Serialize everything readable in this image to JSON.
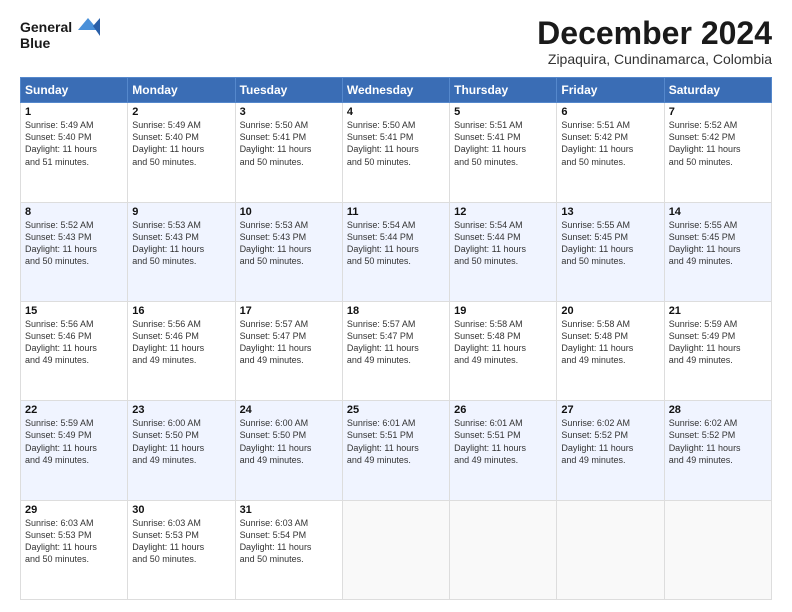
{
  "header": {
    "title": "December 2024",
    "subtitle": "Zipaquira, Cundinamarca, Colombia",
    "logo_line1": "General",
    "logo_line2": "Blue"
  },
  "days_of_week": [
    "Sunday",
    "Monday",
    "Tuesday",
    "Wednesday",
    "Thursday",
    "Friday",
    "Saturday"
  ],
  "weeks": [
    [
      {
        "day": 1,
        "info": "Sunrise: 5:49 AM\nSunset: 5:40 PM\nDaylight: 11 hours\nand 51 minutes."
      },
      {
        "day": 2,
        "info": "Sunrise: 5:49 AM\nSunset: 5:40 PM\nDaylight: 11 hours\nand 50 minutes."
      },
      {
        "day": 3,
        "info": "Sunrise: 5:50 AM\nSunset: 5:41 PM\nDaylight: 11 hours\nand 50 minutes."
      },
      {
        "day": 4,
        "info": "Sunrise: 5:50 AM\nSunset: 5:41 PM\nDaylight: 11 hours\nand 50 minutes."
      },
      {
        "day": 5,
        "info": "Sunrise: 5:51 AM\nSunset: 5:41 PM\nDaylight: 11 hours\nand 50 minutes."
      },
      {
        "day": 6,
        "info": "Sunrise: 5:51 AM\nSunset: 5:42 PM\nDaylight: 11 hours\nand 50 minutes."
      },
      {
        "day": 7,
        "info": "Sunrise: 5:52 AM\nSunset: 5:42 PM\nDaylight: 11 hours\nand 50 minutes."
      }
    ],
    [
      {
        "day": 8,
        "info": "Sunrise: 5:52 AM\nSunset: 5:43 PM\nDaylight: 11 hours\nand 50 minutes."
      },
      {
        "day": 9,
        "info": "Sunrise: 5:53 AM\nSunset: 5:43 PM\nDaylight: 11 hours\nand 50 minutes."
      },
      {
        "day": 10,
        "info": "Sunrise: 5:53 AM\nSunset: 5:43 PM\nDaylight: 11 hours\nand 50 minutes."
      },
      {
        "day": 11,
        "info": "Sunrise: 5:54 AM\nSunset: 5:44 PM\nDaylight: 11 hours\nand 50 minutes."
      },
      {
        "day": 12,
        "info": "Sunrise: 5:54 AM\nSunset: 5:44 PM\nDaylight: 11 hours\nand 50 minutes."
      },
      {
        "day": 13,
        "info": "Sunrise: 5:55 AM\nSunset: 5:45 PM\nDaylight: 11 hours\nand 50 minutes."
      },
      {
        "day": 14,
        "info": "Sunrise: 5:55 AM\nSunset: 5:45 PM\nDaylight: 11 hours\nand 49 minutes."
      }
    ],
    [
      {
        "day": 15,
        "info": "Sunrise: 5:56 AM\nSunset: 5:46 PM\nDaylight: 11 hours\nand 49 minutes."
      },
      {
        "day": 16,
        "info": "Sunrise: 5:56 AM\nSunset: 5:46 PM\nDaylight: 11 hours\nand 49 minutes."
      },
      {
        "day": 17,
        "info": "Sunrise: 5:57 AM\nSunset: 5:47 PM\nDaylight: 11 hours\nand 49 minutes."
      },
      {
        "day": 18,
        "info": "Sunrise: 5:57 AM\nSunset: 5:47 PM\nDaylight: 11 hours\nand 49 minutes."
      },
      {
        "day": 19,
        "info": "Sunrise: 5:58 AM\nSunset: 5:48 PM\nDaylight: 11 hours\nand 49 minutes."
      },
      {
        "day": 20,
        "info": "Sunrise: 5:58 AM\nSunset: 5:48 PM\nDaylight: 11 hours\nand 49 minutes."
      },
      {
        "day": 21,
        "info": "Sunrise: 5:59 AM\nSunset: 5:49 PM\nDaylight: 11 hours\nand 49 minutes."
      }
    ],
    [
      {
        "day": 22,
        "info": "Sunrise: 5:59 AM\nSunset: 5:49 PM\nDaylight: 11 hours\nand 49 minutes."
      },
      {
        "day": 23,
        "info": "Sunrise: 6:00 AM\nSunset: 5:50 PM\nDaylight: 11 hours\nand 49 minutes."
      },
      {
        "day": 24,
        "info": "Sunrise: 6:00 AM\nSunset: 5:50 PM\nDaylight: 11 hours\nand 49 minutes."
      },
      {
        "day": 25,
        "info": "Sunrise: 6:01 AM\nSunset: 5:51 PM\nDaylight: 11 hours\nand 49 minutes."
      },
      {
        "day": 26,
        "info": "Sunrise: 6:01 AM\nSunset: 5:51 PM\nDaylight: 11 hours\nand 49 minutes."
      },
      {
        "day": 27,
        "info": "Sunrise: 6:02 AM\nSunset: 5:52 PM\nDaylight: 11 hours\nand 49 minutes."
      },
      {
        "day": 28,
        "info": "Sunrise: 6:02 AM\nSunset: 5:52 PM\nDaylight: 11 hours\nand 49 minutes."
      }
    ],
    [
      {
        "day": 29,
        "info": "Sunrise: 6:03 AM\nSunset: 5:53 PM\nDaylight: 11 hours\nand 50 minutes."
      },
      {
        "day": 30,
        "info": "Sunrise: 6:03 AM\nSunset: 5:53 PM\nDaylight: 11 hours\nand 50 minutes."
      },
      {
        "day": 31,
        "info": "Sunrise: 6:03 AM\nSunset: 5:54 PM\nDaylight: 11 hours\nand 50 minutes."
      },
      null,
      null,
      null,
      null
    ]
  ]
}
